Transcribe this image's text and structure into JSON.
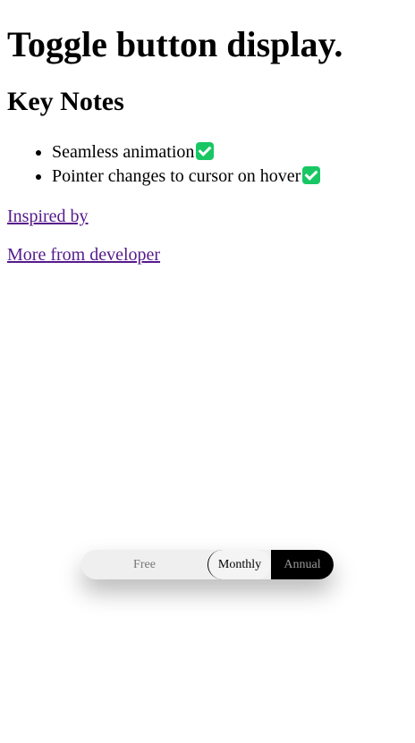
{
  "header": {
    "title": "Toggle button display.",
    "subtitle": "Key Notes"
  },
  "notes": [
    {
      "text": "Seamless animation",
      "icon": "check-icon"
    },
    {
      "text": "Pointer changes to cursor on hover",
      "icon": "check-icon"
    }
  ],
  "links": {
    "inspired": "Inspired by",
    "more": "More from developer"
  },
  "toggle": {
    "options": [
      "Free",
      "Monthly",
      "Annual"
    ],
    "selected": "Monthly"
  },
  "colors": {
    "check": "#18c764",
    "link": "#551a8b",
    "toggle_bg": "#efefef",
    "toggle_dark": "#000000"
  }
}
